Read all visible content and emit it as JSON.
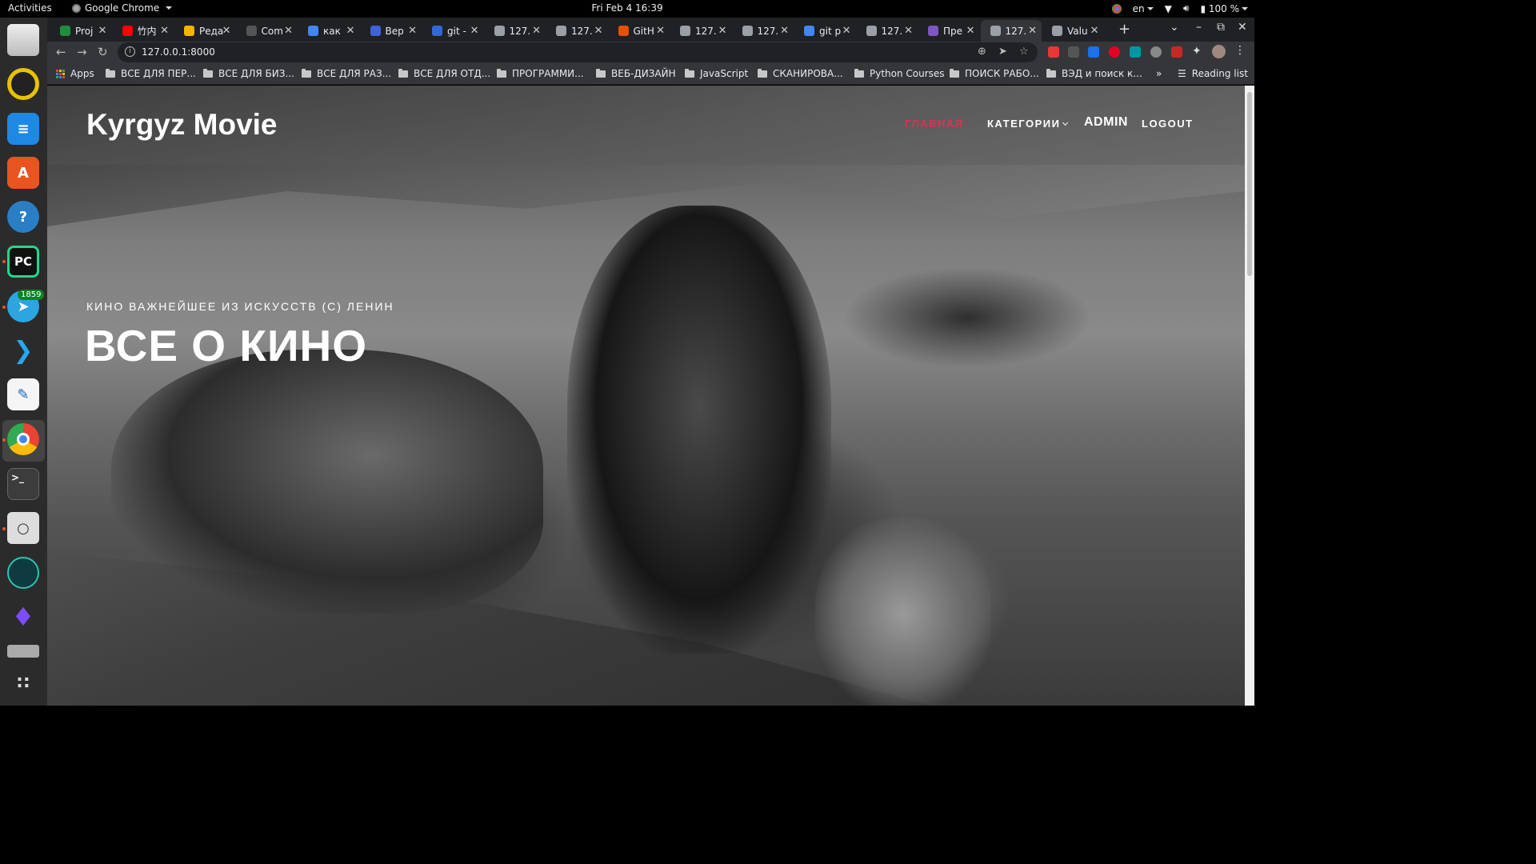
{
  "system": {
    "activities": "Activities",
    "app_name": "Google Chrome",
    "clock": "Fri Feb 4  16:39",
    "language": "en",
    "battery": "100 %"
  },
  "browser": {
    "tabs": [
      {
        "label": "Proj",
        "color": "#1e8e3e"
      },
      {
        "label": "竹内",
        "color": "#ff0000"
      },
      {
        "label": "Реда",
        "color": "#f4b400"
      },
      {
        "label": "Com",
        "color": "#555555"
      },
      {
        "label": "как",
        "color": "#4285f4"
      },
      {
        "label": "Вер",
        "color": "#3c64d8"
      },
      {
        "label": "git -",
        "color": "#3367d6"
      },
      {
        "label": "127.",
        "color": "#9aa0a6"
      },
      {
        "label": "127.",
        "color": "#9aa0a6"
      },
      {
        "label": "GitH",
        "color": "#e65100"
      },
      {
        "label": "127.",
        "color": "#9aa0a6"
      },
      {
        "label": "127.",
        "color": "#9aa0a6"
      },
      {
        "label": "git p",
        "color": "#4285f4"
      },
      {
        "label": "127.",
        "color": "#9aa0a6"
      },
      {
        "label": "Пре",
        "color": "#7e57c2"
      },
      {
        "label": "127.",
        "color": "#9aa0a6"
      },
      {
        "label": "Valu",
        "color": "#9aa0a6"
      }
    ],
    "active_tab_index": 15,
    "url": "127.0.0.1:8000",
    "bookmarks": {
      "apps": "Apps",
      "items": [
        "ВСЕ ДЛЯ ПЕР...",
        "ВСЕ ДЛЯ БИЗ...",
        "ВСЕ ДЛЯ РАЗ...",
        "ВСЕ ДЛЯ ОТД...",
        "ПРОГРАММИ...",
        "ВЕБ-ДИЗАЙН",
        "JavaScript",
        "СКАНИРОВА...",
        "Python Courses",
        "ПОИСК РАБО...",
        "ВЭД и поиск к..."
      ],
      "more": "»",
      "reading_list": "Reading list"
    }
  },
  "dock": {
    "telegram_badge": "1859"
  },
  "site": {
    "brand": "Kyrgyz Movie",
    "nav": {
      "home": "ГЛАВНАЯ",
      "categories": "КАТЕГОРИИ",
      "admin": "ADMIN",
      "logout": "LOGOUT"
    },
    "hero": {
      "subtitle": "КИНО ВАЖНЕЙШЕЕ ИЗ ИСКУССТВ (С) ЛЕНИН",
      "title": "ВСЕ О КИНО"
    },
    "colors": {
      "accent": "#e0304e"
    }
  }
}
